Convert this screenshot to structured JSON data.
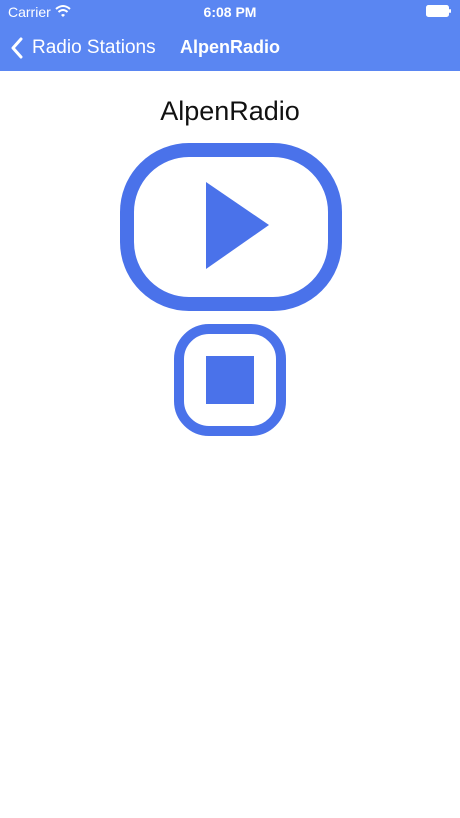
{
  "status_bar": {
    "carrier": "Carrier",
    "time": "6:08 PM",
    "wifi_icon": "wifi-icon",
    "battery_icon": "battery-icon"
  },
  "nav_bar": {
    "back_label": "Radio Stations",
    "back_icon": "chevron-left-icon",
    "title": "AlpenRadio"
  },
  "main": {
    "station_name": "AlpenRadio",
    "play_icon": "play-icon",
    "stop_icon": "stop-icon"
  },
  "colors": {
    "accent": "#5a86f2",
    "icon_blue": "#4a72ea"
  }
}
